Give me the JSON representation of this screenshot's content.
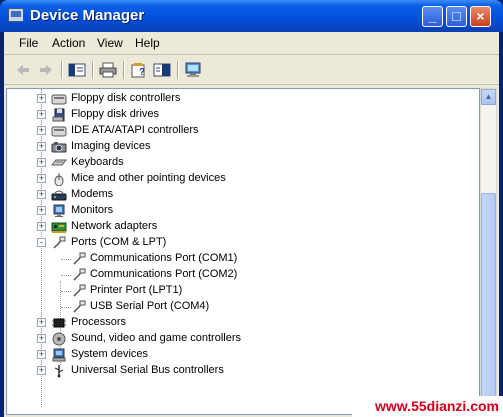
{
  "window": {
    "title": "Device Manager"
  },
  "title_buttons": {
    "minimize": "_",
    "maximize": "□",
    "close": "×"
  },
  "menu": [
    "File",
    "Action",
    "View",
    "Help"
  ],
  "toolbar": [
    "back-arrow-icon",
    "forward-arrow-icon",
    "show-hide-console-tree-icon",
    "print-icon",
    "properties-help-icon",
    "help-icon",
    "scan-hardware-icon"
  ],
  "tree": {
    "categories": [
      {
        "label": "Floppy disk controllers",
        "icon": "floppy-controller-icon",
        "state": "+"
      },
      {
        "label": "Floppy disk drives",
        "icon": "floppy-drive-icon",
        "state": "+"
      },
      {
        "label": "IDE ATA/ATAPI controllers",
        "icon": "ide-controller-icon",
        "state": "+"
      },
      {
        "label": "Imaging devices",
        "icon": "camera-icon",
        "state": "+"
      },
      {
        "label": "Keyboards",
        "icon": "keyboard-icon",
        "state": "+"
      },
      {
        "label": "Mice and other pointing devices",
        "icon": "mouse-icon",
        "state": "+"
      },
      {
        "label": "Modems",
        "icon": "modem-icon",
        "state": "+"
      },
      {
        "label": "Monitors",
        "icon": "monitor-icon",
        "state": "+"
      },
      {
        "label": "Network adapters",
        "icon": "network-adapter-icon",
        "state": "+"
      },
      {
        "label": "Ports (COM & LPT)",
        "icon": "port-icon",
        "state": "-"
      }
    ],
    "ports_children": [
      "Communications Port (COM1)",
      "Communications Port (COM2)",
      "Printer Port (LPT1)",
      "USB Serial Port (COM4)"
    ],
    "categories_after": [
      {
        "label": "Processors",
        "icon": "processor-icon",
        "state": "+"
      },
      {
        "label": "Sound, video and game controllers",
        "icon": "sound-icon",
        "state": "+"
      },
      {
        "label": "System devices",
        "icon": "system-devices-icon",
        "state": "+"
      },
      {
        "label": "Universal Serial Bus controllers",
        "icon": "usb-icon",
        "state": "+"
      }
    ]
  },
  "watermark": "www.55dianzi.com",
  "colors": {
    "title_bar": "#0552de",
    "close_button": "#c9411c",
    "window_bg": "#ece9d8",
    "watermark": "#d0021b"
  }
}
